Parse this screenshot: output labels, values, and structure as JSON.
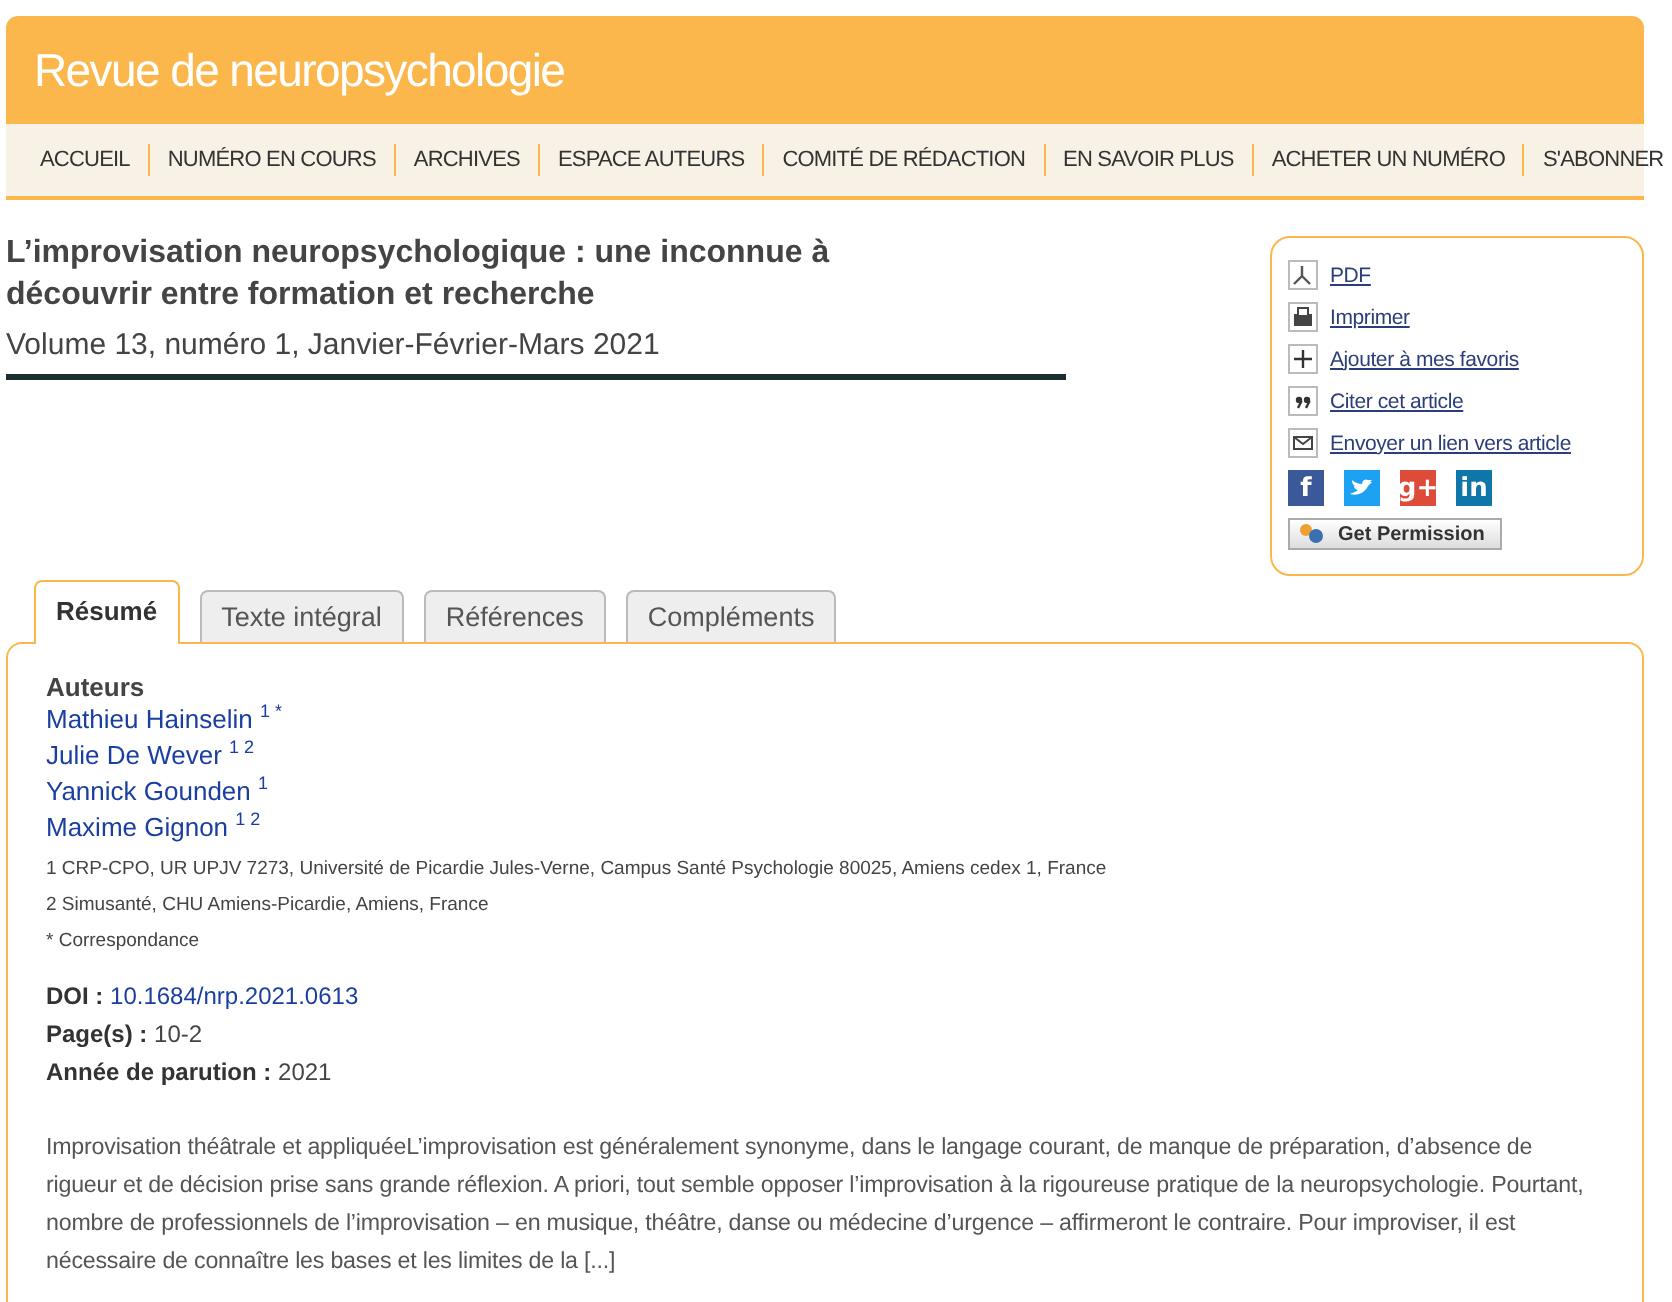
{
  "site": {
    "title": "Revue de neuropsychologie"
  },
  "nav": [
    "ACCUEIL",
    "NUMÉRO EN COURS",
    "ARCHIVES",
    "ESPACE AUTEURS",
    "COMITÉ DE RÉDACTION",
    "EN SAVOIR PLUS",
    "ACHETER UN NUMÉRO",
    "S'ABONNER"
  ],
  "article": {
    "title": "L’improvisation neuropsychologique : une inconnue à découvrir entre formation et recherche",
    "issue": "Volume 13, numéro 1, Janvier-Février-Mars 2021"
  },
  "tools": [
    {
      "kind": "pdf",
      "label": "PDF"
    },
    {
      "kind": "print",
      "label": "Imprimer"
    },
    {
      "kind": "plus",
      "label": "Ajouter à mes favoris"
    },
    {
      "kind": "quote",
      "label": "Citer cet article"
    },
    {
      "kind": "mail",
      "label": "Envoyer un lien vers article"
    }
  ],
  "social": [
    {
      "kind": "letter",
      "glyph": "f",
      "color": "#3b5998"
    },
    {
      "kind": "bird",
      "color": "#1da1f2"
    },
    {
      "kind": "letter",
      "glyph": "g+",
      "color": "#dd4b39"
    },
    {
      "kind": "letter",
      "glyph": "in",
      "color": "#0e76a8"
    }
  ],
  "permission_button": "Get Permission",
  "tabs": [
    {
      "label": "Résumé",
      "selected": true
    },
    {
      "label": "Texte intégral",
      "selected": false
    },
    {
      "label": "Références",
      "selected": false
    },
    {
      "label": "Compléments",
      "selected": false
    }
  ],
  "authors_heading": "Auteurs",
  "authors": [
    {
      "name": "Mathieu Hainselin",
      "marks": "1 *"
    },
    {
      "name": "Julie De Wever",
      "marks": "1 2"
    },
    {
      "name": "Yannick Gounden",
      "marks": "1"
    },
    {
      "name": "Maxime Gignon",
      "marks": "1 2"
    }
  ],
  "affiliations": [
    "1 CRP-CPO, UR UPJV 7273, Université de Picardie Jules-Verne, Campus Santé Psychologie 80025, Amiens cedex 1, France",
    "2 Simusanté, CHU Amiens-Picardie, Amiens, France",
    "* Correspondance"
  ],
  "meta": [
    {
      "label": "DOI :",
      "value": "10.1684/nrp.2021.0613",
      "kind": "link"
    },
    {
      "label": "Page(s) :",
      "value": "10-2",
      "kind": "text"
    },
    {
      "label": "Année de parution :",
      "value": "2021",
      "kind": "text"
    }
  ],
  "abstract": "Improvisation théâtrale et appliquéeL’improvisation est généralement synonyme, dans le langage courant, de manque de préparation, d’absence de rigueur et de décision prise sans grande réflexion. A priori, tout semble opposer l’improvisation à la rigoureuse pratique de la neuropsychologie. Pourtant, nombre de professionnels de l’improvisation – en musique, théâtre, danse ou médecine d’urgence – affirmeront le contraire. Pour improviser, il est nécessaire de connaître les bases et les limites de la [...]"
}
